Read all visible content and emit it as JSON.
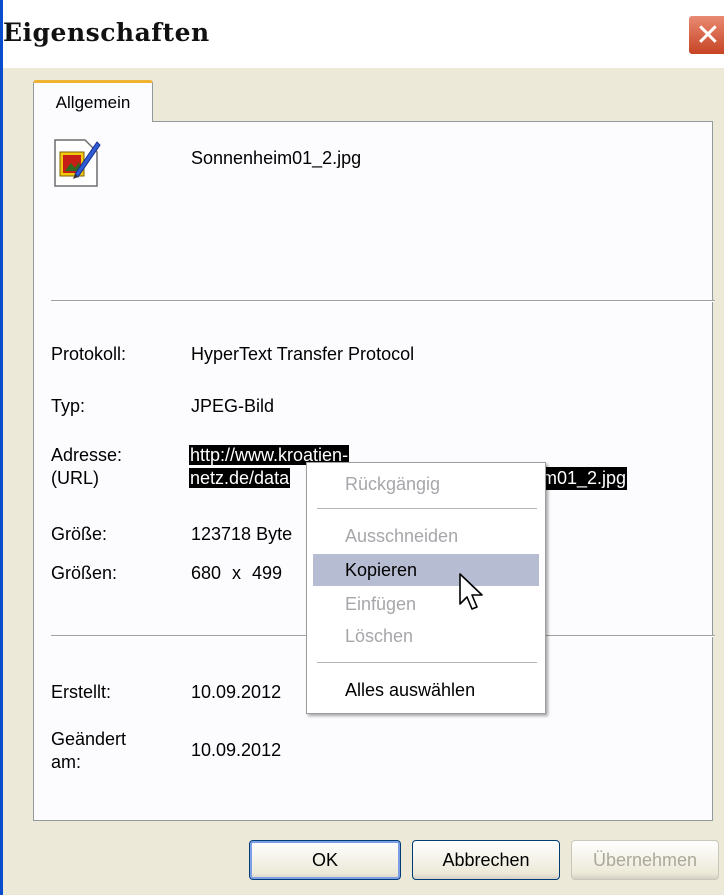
{
  "window": {
    "title": "Eigenschaften",
    "close_glyph": "✕",
    "close_color": "#d4553a"
  },
  "tabs": [
    {
      "label": "Allgemein",
      "selected": true
    }
  ],
  "file": {
    "icon": "image-file-icon",
    "name": "Sonnenheim01_2.jpg"
  },
  "properties": {
    "protocol": {
      "label": "Protokoll:",
      "value": "HyperText Transfer Protocol"
    },
    "type": {
      "label": "Typ:",
      "value": "JPEG-Bild"
    },
    "address": {
      "label_line1": "Adresse:",
      "label_line2": "(URL)",
      "value_line1": "http://www.kroatien-",
      "value_line2": "netz.de/data",
      "value_line2_end": "m01_2.jpg"
    },
    "size": {
      "label": "Größe:",
      "value": "123718 Byte"
    },
    "dimensions": {
      "label": "Größen:",
      "value": "680 x 499"
    },
    "created": {
      "label": "Erstellt:",
      "value": "10.09.2012"
    },
    "modified": {
      "label_line1": "Geändert",
      "label_line2": "am:",
      "value": "10.09.2012"
    }
  },
  "context_menu": {
    "items": [
      {
        "label": "Rückgängig",
        "enabled": false
      },
      {
        "label": "Ausschneiden",
        "enabled": false
      },
      {
        "label": "Kopieren",
        "enabled": true,
        "highlighted": true
      },
      {
        "label": "Einfügen",
        "enabled": false
      },
      {
        "label": "Löschen",
        "enabled": false
      },
      {
        "label": "Alles auswählen",
        "enabled": true
      }
    ],
    "highlight_color": "#b6bdd2"
  },
  "buttons": {
    "ok": "OK",
    "cancel": "Abbrechen",
    "apply": "Übernehmen"
  }
}
